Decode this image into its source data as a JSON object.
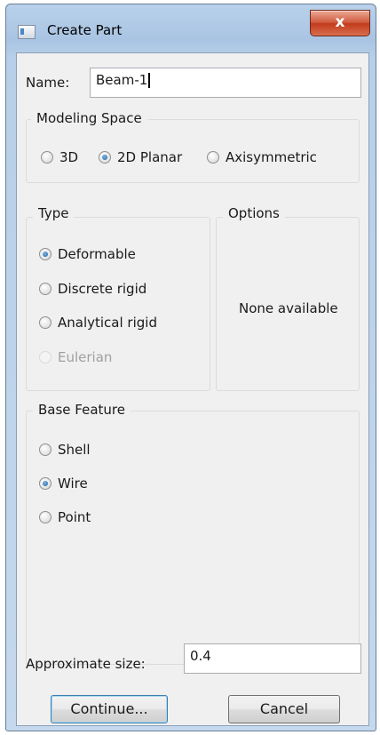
{
  "window": {
    "title": "Create Part",
    "close_glyph": "x"
  },
  "name_field": {
    "label": "Name:",
    "value": "Beam-1"
  },
  "modeling_space": {
    "title": "Modeling Space",
    "options": [
      {
        "label": "3D",
        "checked": false
      },
      {
        "label": "2D Planar",
        "checked": true
      },
      {
        "label": "Axisymmetric",
        "checked": false
      }
    ]
  },
  "type": {
    "title": "Type",
    "options": [
      {
        "label": "Deformable",
        "checked": true,
        "enabled": true
      },
      {
        "label": "Discrete rigid",
        "checked": false,
        "enabled": true
      },
      {
        "label": "Analytical rigid",
        "checked": false,
        "enabled": true
      },
      {
        "label": "Eulerian",
        "checked": false,
        "enabled": false
      }
    ]
  },
  "options_panel": {
    "title": "Options",
    "message": "None available"
  },
  "base_feature": {
    "title": "Base Feature",
    "options": [
      {
        "label": "Shell",
        "checked": false
      },
      {
        "label": "Wire",
        "checked": true
      },
      {
        "label": "Point",
        "checked": false
      }
    ]
  },
  "approx_size": {
    "label": "Approximate size:",
    "value": "0.4"
  },
  "buttons": {
    "continue_label": "Continue...",
    "cancel_label": "Cancel"
  },
  "icons": {
    "app": "window-app-icon",
    "close": "close-icon"
  },
  "colors": {
    "titlebar": "#b9d1ea",
    "close_button": "#c9442a",
    "dialog_background": "#f0f0f0",
    "radio_checked": "#1f5f9e"
  }
}
